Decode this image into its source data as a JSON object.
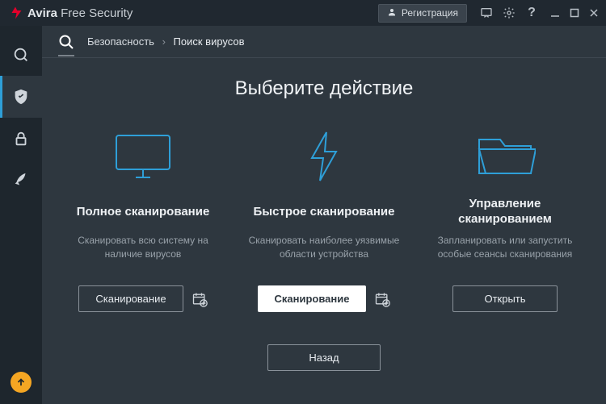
{
  "brand": {
    "name": "Avira",
    "suffix": "Free Security"
  },
  "titlebar": {
    "register_label": "Регистрация"
  },
  "breadcrumb": {
    "root": "Безопасность",
    "current": "Поиск вирусов"
  },
  "page": {
    "title": "Выберите действие"
  },
  "cards": [
    {
      "title": "Полное сканирование",
      "desc": "Сканировать всю систему на наличие вирусов",
      "button": "Сканирование"
    },
    {
      "title": "Быстрое сканирование",
      "desc": "Сканировать наиболее уязвимые области устройства",
      "button": "Сканирование"
    },
    {
      "title": "Управление сканированием",
      "desc": "Запланировать или запустить особые сеансы сканирования",
      "button": "Открыть"
    }
  ],
  "back_label": "Назад"
}
